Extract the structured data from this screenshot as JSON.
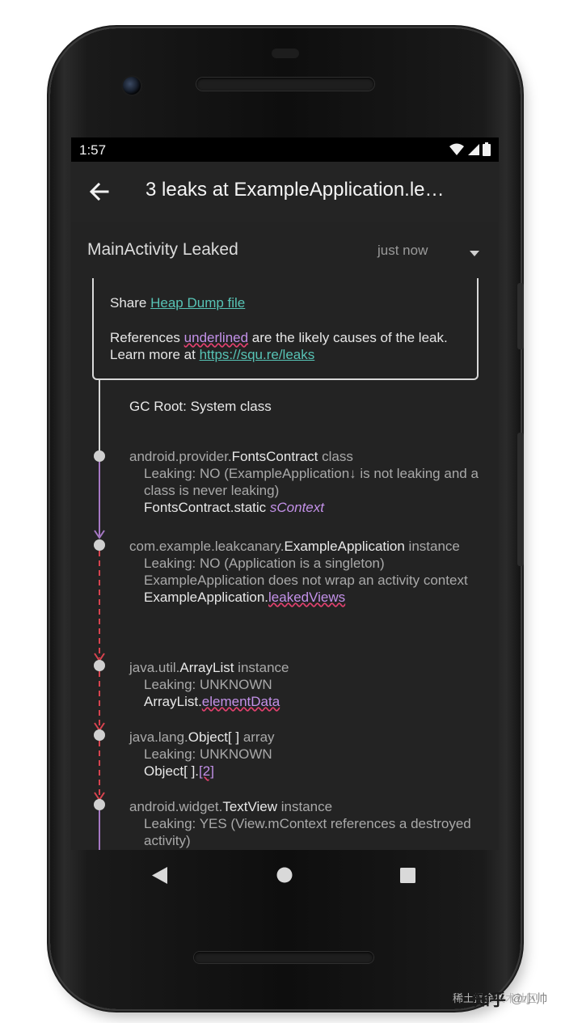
{
  "status_bar": {
    "time": "1:57",
    "icons": [
      "wifi-icon",
      "cell-signal-icon",
      "battery-icon"
    ]
  },
  "app_bar": {
    "back_icon": "arrow-back-icon",
    "title": "3 leaks at ExampleApplication.le…"
  },
  "leak_header": {
    "title": "MainActivity Leaked",
    "time": "just now",
    "expand_icon": "dropdown-arrow-icon"
  },
  "info": {
    "share_prefix": "Share ",
    "share_link": "Heap Dump file",
    "refs_prefix": "References ",
    "refs_underlined": "underlined",
    "refs_suffix": " are the likely causes of the leak. Learn more at ",
    "refs_link": "https://squ.re/leaks"
  },
  "trace": {
    "gc_root": "GC Root: System class",
    "nodes": [
      {
        "pkg": "android.provider.",
        "cls": "FontsContract",
        "kind": " class",
        "leaking": "Leaking: NO (ExampleApplication↓ is not leaking and a class is never leaking)",
        "ref_owner": "FontsContract.static ",
        "ref_field": "sContext"
      },
      {
        "pkg": "com.example.leakcanary.",
        "cls": "ExampleApplication",
        "kind": " instance",
        "leaking": "Leaking: NO (Application is a singleton)",
        "note": "ExampleApplication does not wrap an activity context",
        "ref_owner": "ExampleApplication.",
        "ref_field": "leakedViews"
      },
      {
        "pkg": "java.util.",
        "cls": "ArrayList",
        "kind": " instance",
        "leaking": "Leaking: UNKNOWN",
        "ref_owner": "ArrayList.",
        "ref_field": "elementData"
      },
      {
        "pkg": "java.lang.",
        "cls": "Object[ ]",
        "kind": " array",
        "leaking": "Leaking: UNKNOWN",
        "ref_owner": "Object[ ].",
        "ref_field": "[2]"
      },
      {
        "pkg": "android.widget.",
        "cls": "TextView",
        "kind": " instance",
        "leaking": "Leaking: YES (View.mContext references a destroyed activity)"
      }
    ]
  },
  "nav_bar": {
    "back": "nav-back-icon",
    "home": "nav-home-icon",
    "recents": "nav-recents-icon"
  },
  "watermark": {
    "site": "知乎",
    "author": "@小帅",
    "faint": "稀土掘金技术社区"
  },
  "colors": {
    "link": "#57c3b5",
    "suspect": "#c391e8",
    "squiggle": "#e0406e",
    "leak_line": "#d8434f",
    "safe_line": "#a678c4"
  }
}
